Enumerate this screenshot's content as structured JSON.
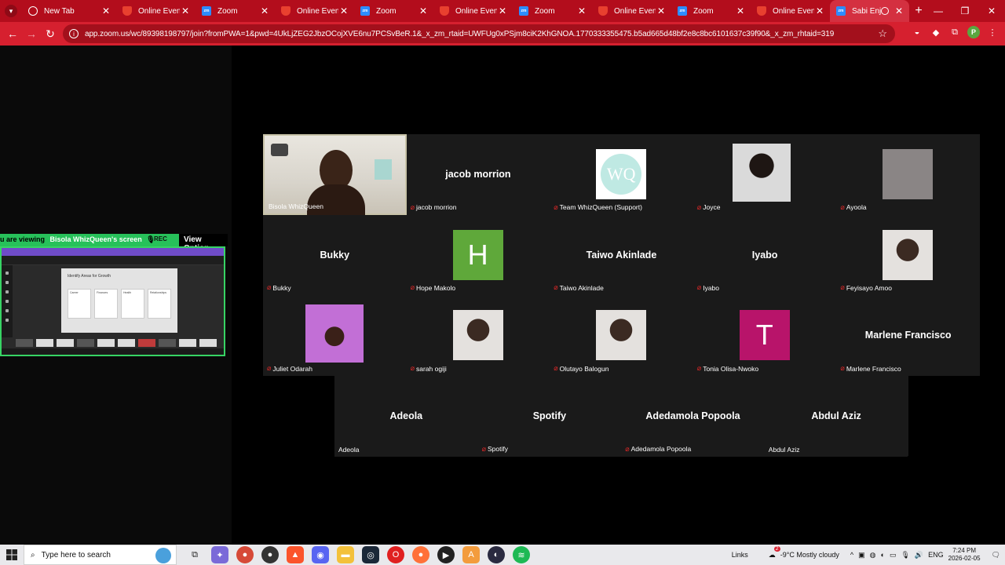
{
  "browser": {
    "tabs": [
      {
        "title": "New Tab",
        "icon": "globe-icon"
      },
      {
        "title": "Online Event P",
        "icon": "shield-icon"
      },
      {
        "title": "Zoom",
        "icon": "zoom-icon"
      },
      {
        "title": "Online Event P",
        "icon": "shield-icon"
      },
      {
        "title": "Zoom",
        "icon": "zoom-icon"
      },
      {
        "title": "Online Event P",
        "icon": "shield-icon"
      },
      {
        "title": "Zoom",
        "icon": "zoom-icon"
      },
      {
        "title": "Online Event P",
        "icon": "shield-icon"
      },
      {
        "title": "Zoom",
        "icon": "zoom-icon"
      },
      {
        "title": "Online Event P",
        "icon": "shield-icon"
      },
      {
        "title": "Sabi Enjoy",
        "icon": "zoom-icon",
        "active": true
      }
    ],
    "url": "app.zoom.us/wc/89398198797/join?fromPWA=1&pwd=4UkLjZEG2JbzOCojXVE6nu7PCSvBeR.1&_x_zm_rtaid=UWFUg0xPSjm8ciK2KhGNOA.1770333355475.b5ad665d48bf2e8c8bc6101637c39f90&_x_zm_rhtaid=319",
    "profile_initial": "P",
    "theme_color": "#d6202f"
  },
  "share": {
    "viewing_prefix": "u are viewing",
    "presenter": "Bisola WhizQueen's screen",
    "rec": "REC",
    "view_options": "View Option",
    "slide_title": "Identify Areas for Growth",
    "slide_cards": [
      "Career",
      "Finances",
      "Health",
      "Relationships"
    ]
  },
  "participants": [
    {
      "name": "Bisola WhizQueen",
      "display": "",
      "muted": false,
      "video": true,
      "active_speaker": true
    },
    {
      "name": "jacob morrion",
      "display": "jacob morrion",
      "muted": true
    },
    {
      "name": "Team WhizQueen (Support)",
      "display": "",
      "muted": true,
      "avatar": "WQ"
    },
    {
      "name": "Joyce",
      "display": "",
      "muted": true,
      "avatar": "photo"
    },
    {
      "name": "Ayoola",
      "display": "",
      "muted": true,
      "avatar": "blur"
    },
    {
      "name": "Bukky",
      "display": "Bukky",
      "muted": true
    },
    {
      "name": "Hope Makolo",
      "display": "",
      "muted": true,
      "avatar_letter": "H",
      "avatar_color": "#5fa83a"
    },
    {
      "name": "Taiwo Akinlade",
      "display": "Taiwo Akinlade",
      "muted": true
    },
    {
      "name": "Iyabo",
      "display": "Iyabo",
      "muted": true
    },
    {
      "name": "Feyisayo Amoo",
      "display": "",
      "muted": true,
      "avatar": "photo"
    },
    {
      "name": "Juliet Odarah",
      "display": "",
      "muted": true,
      "avatar": "flowers"
    },
    {
      "name": "sarah ogiji",
      "display": "",
      "muted": true,
      "avatar": "photo"
    },
    {
      "name": "Olutayo Balogun",
      "display": "",
      "muted": true,
      "avatar": "photo"
    },
    {
      "name": "Tonia Olisa-Nwoko",
      "display": "",
      "muted": true,
      "avatar_letter": "T",
      "avatar_color": "#b8146a"
    },
    {
      "name": "Marlene Francisco",
      "display": "Marlene Francisco",
      "muted": true
    },
    {
      "name": "Adeola",
      "display": "Adeola",
      "muted": false
    },
    {
      "name": "Spotify",
      "display": "Spotify",
      "muted": true
    },
    {
      "name": "Adedamola Popoola",
      "display": "Adedamola Popoola",
      "muted": true
    },
    {
      "name": "Abdul Aziz",
      "display": "Abdul Aziz",
      "muted": false
    }
  ],
  "taskbar": {
    "search_placeholder": "Type here to search",
    "links": "Links",
    "weather_badge": "2",
    "weather": "-9°C  Mostly cloudy",
    "lang": "ENG",
    "time": "7:24 PM",
    "date": "2026-02-05"
  }
}
